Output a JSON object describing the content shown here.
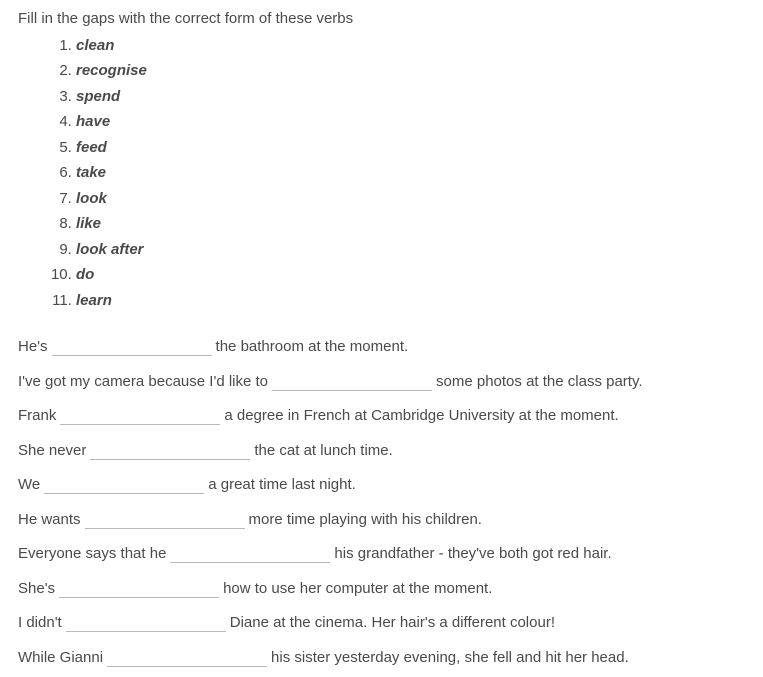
{
  "instruction": "Fill in the gaps with the correct form of these verbs",
  "verbs": [
    "clean",
    "recognise",
    "spend",
    "have",
    "feed",
    "take",
    "look",
    "like",
    "look after",
    "do",
    "learn"
  ],
  "sentences": [
    {
      "before": "He's",
      "after": "the bathroom at the moment."
    },
    {
      "before": "I've got my camera because I'd like to",
      "after": "some photos at the class party."
    },
    {
      "before": "Frank",
      "after": "a degree in French at Cambridge University at the moment."
    },
    {
      "before": "She never",
      "after": "the cat at lunch time."
    },
    {
      "before": "We",
      "after": "a great time last night."
    },
    {
      "before": "He wants",
      "after": "more time playing with his children."
    },
    {
      "before": "Everyone says that he",
      "after": "his grandfather - they've both got red hair."
    },
    {
      "before": "She's",
      "after": "how to use her computer at the moment."
    },
    {
      "before": "I didn't",
      "after": "Diane at the cinema. Her hair's a different colour!"
    },
    {
      "before": "While Gianni",
      "after": "his sister yesterday evening, she fell and hit her head."
    }
  ]
}
